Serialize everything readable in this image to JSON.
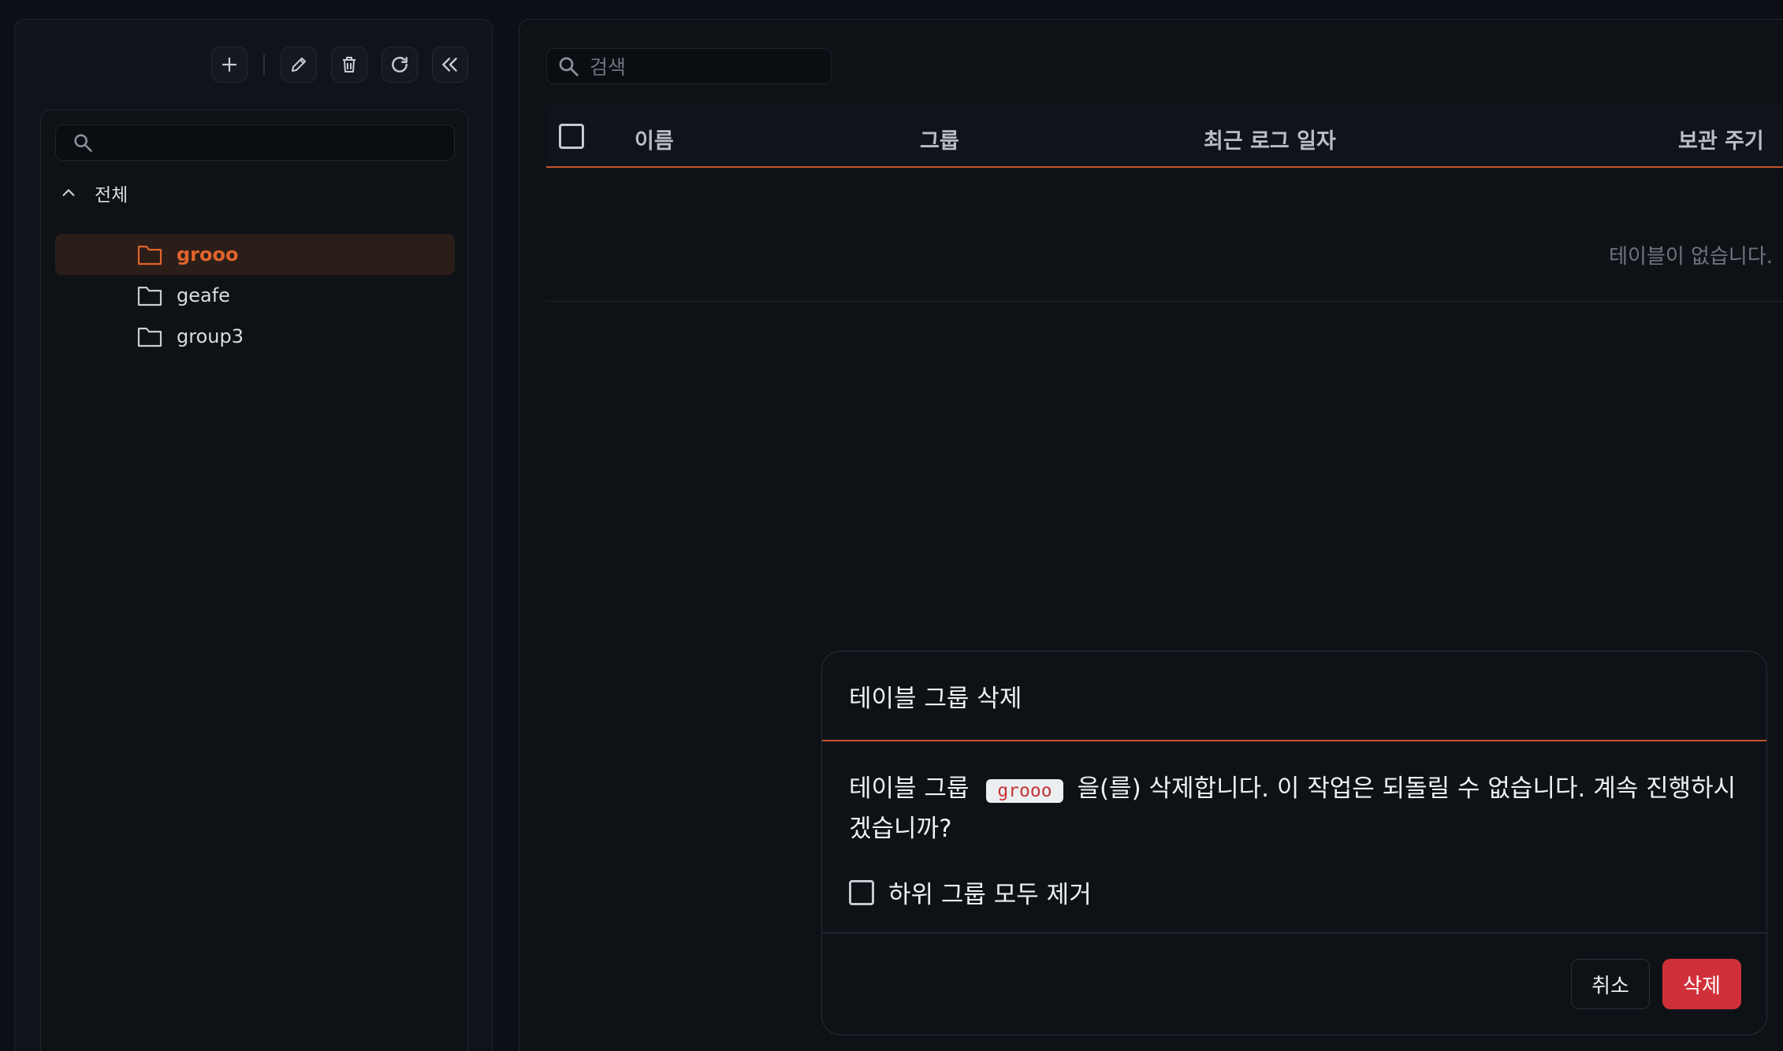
{
  "sidebar": {
    "toolbar": {
      "icons": [
        "plus-icon",
        "pencil-icon",
        "trash-icon",
        "refresh-icon",
        "chevrons-left-icon"
      ]
    },
    "tree": {
      "search_placeholder": "",
      "root_label": "전체",
      "items": [
        {
          "label": "grooo",
          "selected": true
        },
        {
          "label": "geafe",
          "selected": false
        },
        {
          "label": "group3",
          "selected": false
        }
      ]
    }
  },
  "main": {
    "search_placeholder": "검색",
    "table": {
      "columns": [
        "이름",
        "그룹",
        "최근 로그 일자",
        "보관 주기"
      ],
      "empty_text": "테이블이 없습니다."
    }
  },
  "dialog": {
    "title": "테이블 그룹 삭제",
    "message_prefix": "테이블 그룹",
    "group_name": "grooo",
    "message_suffix": "을(를) 삭제합니다. 이 작업은 되돌릴 수 없습니다. 계속 진행하시겠습니까?",
    "checkbox_label": "하위 그룹 모두 제거",
    "cancel_label": "취소",
    "delete_label": "삭제"
  },
  "colors": {
    "accent": "#e0642c",
    "danger": "#d0303a"
  }
}
